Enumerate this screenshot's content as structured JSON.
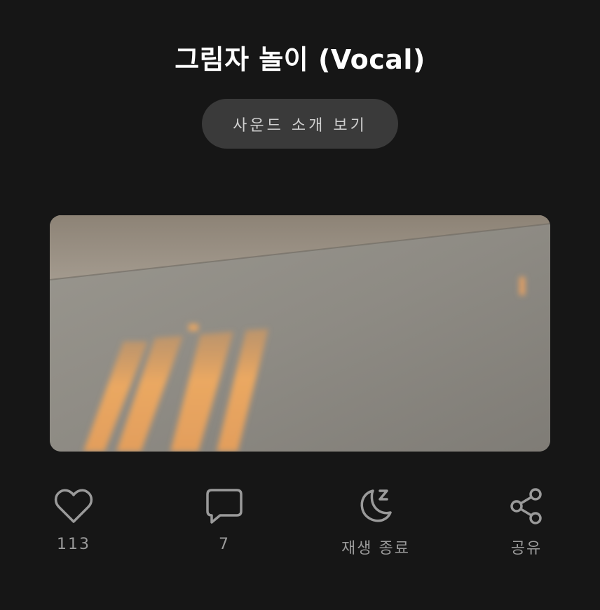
{
  "sound": {
    "title": "그림자 놀이 (Vocal)",
    "intro_button_label": "사운드 소개 보기"
  },
  "actions": {
    "like": {
      "icon": "heart-icon",
      "count": "113"
    },
    "comment": {
      "icon": "comment-icon",
      "count": "7"
    },
    "sleep_timer": {
      "icon": "moon-sleep-icon",
      "label": "재생 종료"
    },
    "share": {
      "icon": "share-icon",
      "label": "공유"
    }
  },
  "colors": {
    "background": "#161616",
    "button_bg": "#3a3a3a",
    "icon_gray": "#9a9a9a",
    "sunlight": "#e8a560"
  }
}
